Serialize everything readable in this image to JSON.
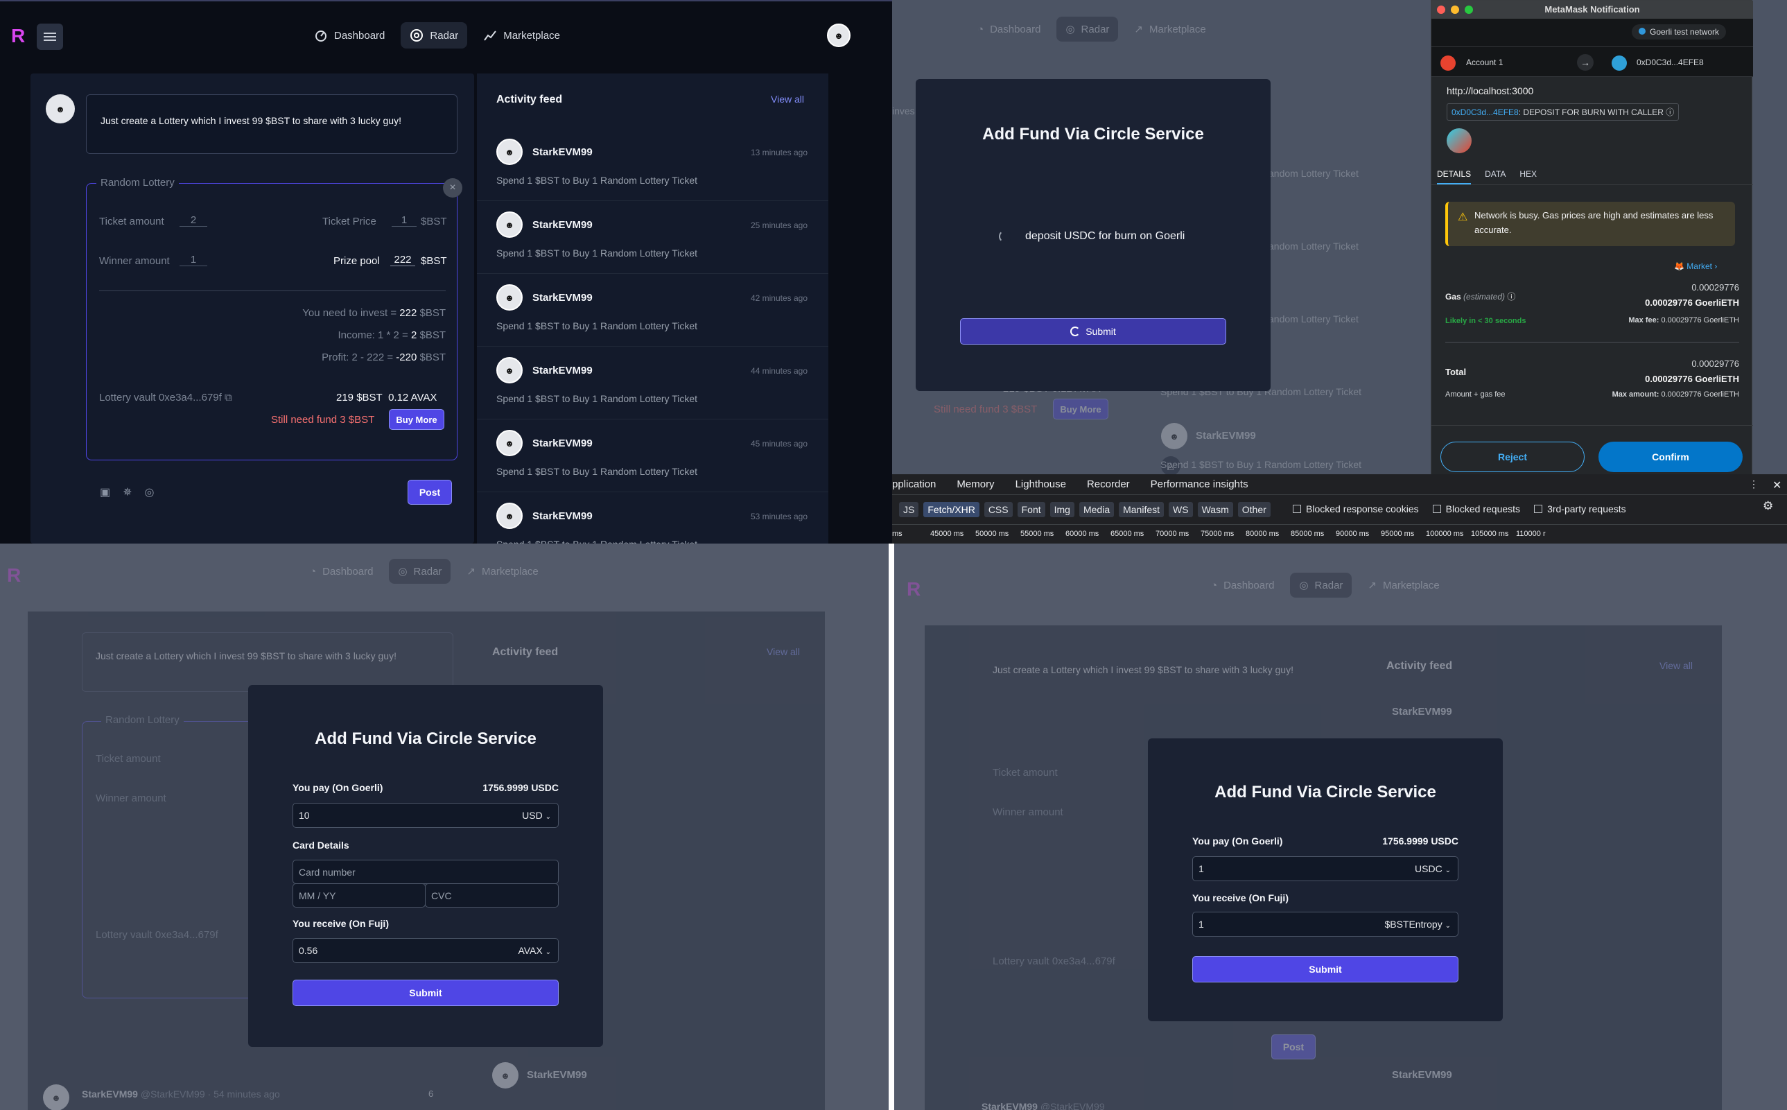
{
  "brand": {
    "logo_letter": "R"
  },
  "nav": {
    "dashboard": "Dashboard",
    "radar": "Radar",
    "marketplace": "Marketplace"
  },
  "composer": {
    "text": "Just create a Lottery which I invest 99 $BST to share with 3 lucky guy!",
    "post": "Post"
  },
  "lottery": {
    "title": "Random Lottery",
    "ticket_amount_label": "Ticket amount",
    "ticket_amount": "2",
    "ticket_price_label": "Ticket Price",
    "ticket_price": "1",
    "currency": "$BST",
    "winner_amount_label": "Winner amount",
    "winner_amount": "1",
    "prize_pool_label": "Prize pool",
    "prize_pool": "222",
    "invest_label": "You need to invest",
    "eq": "=",
    "invest": "222",
    "income_label": "Income: 1 * 2",
    "income": "2",
    "profit_label": "Profit: 2 - 222",
    "profit": "-220",
    "vault_label": "Lottery vault",
    "vault_addr": "0xe3a4...679f",
    "vault_bst": "219 $BST",
    "vault_avax": "0.12 AVAX",
    "need_fund": "Still need fund 3 $BST",
    "buy_more": "Buy More"
  },
  "feed": {
    "title": "Activity feed",
    "view_all": "View all",
    "items": [
      {
        "user": "StarkEVM99",
        "time": "13 minutes ago",
        "text": "Spend 1 $BST to Buy 1 Random Lottery Ticket"
      },
      {
        "user": "StarkEVM99",
        "time": "25 minutes ago",
        "text": "Spend 1 $BST to Buy 1 Random Lottery Ticket"
      },
      {
        "user": "StarkEVM99",
        "time": "42 minutes ago",
        "text": "Spend 1 $BST to Buy 1 Random Lottery Ticket"
      },
      {
        "user": "StarkEVM99",
        "time": "44 minutes ago",
        "text": "Spend 1 $BST to Buy 1 Random Lottery Ticket"
      },
      {
        "user": "StarkEVM99",
        "time": "45 minutes ago",
        "text": "Spend 1 $BST to Buy 1 Random Lottery Ticket"
      },
      {
        "user": "StarkEVM99",
        "time": "53 minutes ago",
        "text": "Spend 1 $BST to Buy 1 Random Lottery Ticket"
      }
    ]
  },
  "post_meta": {
    "user": "StarkEVM99",
    "handle": "@StarkEVM99",
    "sep": "·",
    "time": "54 minutes ago",
    "count": "6"
  },
  "circle": {
    "title": "Add Fund Via Circle Service",
    "loading": "deposit USDC for burn on Goerli",
    "submit": "Submit",
    "you_pay": "You pay (On Goerli)",
    "balance": "1756.9999 USDC",
    "pay_amount_a": "10",
    "pay_currency_a": "USD",
    "card_details": "Card Details",
    "card_number_ph": "Card number",
    "expiry_ph": "MM / YY",
    "cvc_ph": "CVC",
    "you_receive": "You receive (On Fuji)",
    "recv_amount_a": "0.56",
    "recv_currency_a": "AVAX",
    "pay_amount_b": "1",
    "pay_currency_b": "USDC",
    "recv_amount_b": "1",
    "recv_currency_b": "$BSTEntropy"
  },
  "metamask": {
    "window_title": "MetaMask Notification",
    "network": "Goerli test network",
    "account": "Account 1",
    "to_addr": "0xD0C3d...4EFE8",
    "origin": "http://localhost:3000",
    "contract": "0xD0C3d...4EFE8",
    "method": ": DEPOSIT FOR BURN WITH CALLER",
    "tabs": [
      "DETAILS",
      "DATA",
      "HEX"
    ],
    "warning": "Network is busy. Gas prices are high and estimates are less accurate.",
    "market": "Market",
    "gas_label": "Gas",
    "gas_est": "(estimated)",
    "gas_value": "0.00029776",
    "gas_eth": "0.00029776 GoerliETH",
    "likely": "Likely in < 30 seconds",
    "max_fee_label": "Max fee:",
    "max_fee": "0.00029776 GoerliETH",
    "total_label": "Total",
    "total_value": "0.00029776",
    "total_eth": "0.00029776 GoerliETH",
    "amount_gas": "Amount + gas fee",
    "max_amount_label": "Max amount:",
    "max_amount": "0.00029776 GoerliETH",
    "reject": "Reject",
    "confirm": "Confirm"
  },
  "devtools": {
    "tabs": [
      "pplication",
      "Memory",
      "Lighthouse",
      "Recorder",
      "Performance insights"
    ],
    "filters": [
      "JS",
      "Fetch/XHR",
      "CSS",
      "Font",
      "Img",
      "Media",
      "Manifest",
      "WS",
      "Wasm",
      "Other"
    ],
    "checks": [
      "Blocked response cookies",
      "Blocked requests",
      "3rd-party requests"
    ],
    "ticks": [
      "ms",
      "45000 ms",
      "50000 ms",
      "55000 ms",
      "60000 ms",
      "65000 ms",
      "70000 ms",
      "75000 ms",
      "80000 ms",
      "85000 ms",
      "90000 ms",
      "95000 ms",
      "100000 ms",
      "105000 ms",
      "110000 r"
    ]
  },
  "bg_fragments": {
    "invest_short": "inves",
    "vault_amount": "219 $BST  0.12 AVAX",
    "need_fund": "Still need fund 3 $BST",
    "buy_more": "Buy More",
    "lottery_short": "andom Lottery Ticket",
    "vault_short": "Lottery vault  0xe3a4...679f"
  },
  "colors": {
    "accent": "#4f46e5",
    "metamask_blue": "#0376c9",
    "danger": "#f87171",
    "success": "#28a745"
  }
}
